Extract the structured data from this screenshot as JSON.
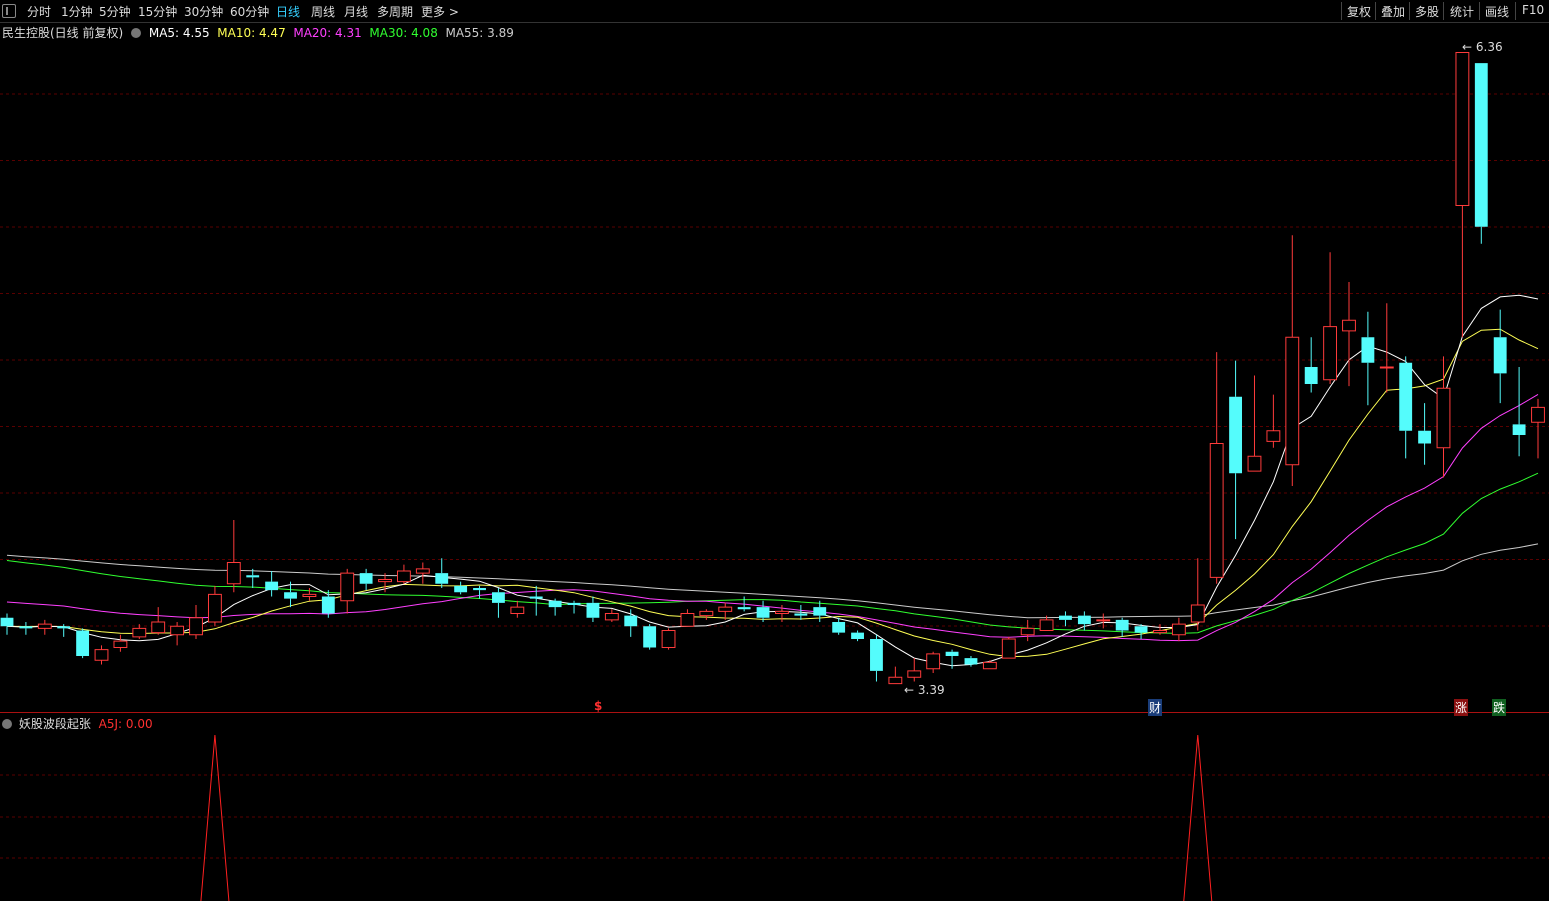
{
  "toolbar": {
    "periods": [
      "分时",
      "1分钟",
      "5分钟",
      "15分钟",
      "30分钟",
      "60分钟",
      "日线",
      "周线",
      "月线",
      "多周期",
      "更多 >"
    ],
    "active_period": "日线",
    "right_buttons": [
      "复权",
      "叠加",
      "多股",
      "统计",
      "画线",
      "F10"
    ]
  },
  "main_chart": {
    "title": "民生控股(日线 前复权)",
    "ma": [
      {
        "label": "MA5:",
        "value": "4.55",
        "color": "#ffffff"
      },
      {
        "label": "MA10:",
        "value": "4.47",
        "color": "#ffff55"
      },
      {
        "label": "MA20:",
        "value": "4.31",
        "color": "#ff40ff"
      },
      {
        "label": "MA30:",
        "value": "4.08",
        "color": "#30ff30"
      },
      {
        "label": "MA55:",
        "value": "3.89",
        "color": "#cccccc"
      }
    ],
    "high_label": "6.36",
    "low_label": "3.39",
    "markers": [
      {
        "text": "$",
        "color": "#ff3030"
      },
      {
        "text": "财",
        "color": "#ffffff",
        "bg": "#1a3d7a"
      },
      {
        "text": "涨",
        "color": "#ffffff",
        "bg": "#8a1010"
      },
      {
        "text": "跌",
        "color": "#ffffff",
        "bg": "#106020"
      }
    ]
  },
  "sub_chart": {
    "title": "妖股波段起张",
    "indicator": "A5J: 0.00"
  },
  "colors": {
    "up": "#ff3b3b",
    "down": "#54fcfc",
    "grid": "#5a0000",
    "ma5": "#ffffff",
    "ma10": "#ffff55",
    "ma20": "#ff40ff",
    "ma30": "#30ff30",
    "ma55": "#cccccc"
  },
  "chart_data": {
    "type": "candlestick",
    "series_order": [
      "open",
      "close",
      "high",
      "low"
    ],
    "candles": [
      [
        3.7,
        3.66,
        3.72,
        3.62
      ],
      [
        3.66,
        3.65,
        3.68,
        3.62
      ],
      [
        3.65,
        3.67,
        3.69,
        3.62
      ],
      [
        3.66,
        3.65,
        3.67,
        3.61
      ],
      [
        3.64,
        3.52,
        3.65,
        3.51
      ],
      [
        3.5,
        3.55,
        3.57,
        3.48
      ],
      [
        3.56,
        3.59,
        3.62,
        3.54
      ],
      [
        3.61,
        3.65,
        3.67,
        3.6
      ],
      [
        3.63,
        3.68,
        3.75,
        3.62
      ],
      [
        3.62,
        3.66,
        3.68,
        3.57
      ],
      [
        3.62,
        3.7,
        3.76,
        3.6
      ],
      [
        3.68,
        3.81,
        3.85,
        3.66
      ],
      [
        3.86,
        3.96,
        4.16,
        3.82
      ],
      [
        3.9,
        3.89,
        3.93,
        3.84
      ],
      [
        3.87,
        3.83,
        3.92,
        3.8
      ],
      [
        3.82,
        3.79,
        3.87,
        3.75
      ],
      [
        3.8,
        3.81,
        3.84,
        3.78
      ],
      [
        3.8,
        3.72,
        3.83,
        3.7
      ],
      [
        3.78,
        3.91,
        3.93,
        3.72
      ],
      [
        3.91,
        3.86,
        3.93,
        3.83
      ],
      [
        3.87,
        3.88,
        3.91,
        3.82
      ],
      [
        3.87,
        3.92,
        3.95,
        3.86
      ],
      [
        3.91,
        3.93,
        3.96,
        3.86
      ],
      [
        3.91,
        3.86,
        3.98,
        3.84
      ],
      [
        3.85,
        3.82,
        3.87,
        3.81
      ],
      [
        3.84,
        3.83,
        3.85,
        3.79
      ],
      [
        3.82,
        3.77,
        3.84,
        3.7
      ],
      [
        3.72,
        3.75,
        3.78,
        3.7
      ],
      [
        3.8,
        3.79,
        3.85,
        3.71
      ],
      [
        3.78,
        3.75,
        3.79,
        3.71
      ],
      [
        3.77,
        3.76,
        3.78,
        3.72
      ],
      [
        3.77,
        3.7,
        3.8,
        3.68
      ],
      [
        3.69,
        3.72,
        3.74,
        3.68
      ],
      [
        3.71,
        3.66,
        3.74,
        3.61
      ],
      [
        3.66,
        3.56,
        3.67,
        3.55
      ],
      [
        3.56,
        3.64,
        3.65,
        3.55
      ],
      [
        3.66,
        3.72,
        3.74,
        3.66
      ],
      [
        3.71,
        3.73,
        3.74,
        3.69
      ],
      [
        3.73,
        3.75,
        3.77,
        3.69
      ],
      [
        3.75,
        3.74,
        3.8,
        3.73
      ],
      [
        3.75,
        3.7,
        3.78,
        3.68
      ],
      [
        3.72,
        3.73,
        3.76,
        3.68
      ],
      [
        3.72,
        3.71,
        3.76,
        3.69
      ],
      [
        3.75,
        3.71,
        3.78,
        3.68
      ],
      [
        3.68,
        3.63,
        3.7,
        3.62
      ],
      [
        3.63,
        3.6,
        3.64,
        3.59
      ],
      [
        3.6,
        3.45,
        3.62,
        3.4
      ],
      [
        3.39,
        3.42,
        3.47,
        3.39
      ],
      [
        3.42,
        3.45,
        3.51,
        3.4
      ],
      [
        3.46,
        3.53,
        3.54,
        3.44
      ],
      [
        3.54,
        3.52,
        3.55,
        3.46
      ],
      [
        3.51,
        3.48,
        3.52,
        3.47
      ],
      [
        3.46,
        3.49,
        3.5,
        3.46
      ],
      [
        3.51,
        3.6,
        3.61,
        3.51
      ],
      [
        3.62,
        3.65,
        3.69,
        3.59
      ],
      [
        3.64,
        3.69,
        3.71,
        3.64
      ],
      [
        3.71,
        3.69,
        3.73,
        3.66
      ],
      [
        3.71,
        3.67,
        3.73,
        3.64
      ],
      [
        3.69,
        3.69,
        3.72,
        3.65
      ],
      [
        3.69,
        3.64,
        3.7,
        3.61
      ],
      [
        3.66,
        3.63,
        3.67,
        3.6
      ],
      [
        3.63,
        3.64,
        3.67,
        3.62
      ],
      [
        3.62,
        3.67,
        3.7,
        3.59
      ],
      [
        3.68,
        3.76,
        3.98,
        3.64
      ],
      [
        3.89,
        4.52,
        4.95,
        3.86
      ],
      [
        4.74,
        4.38,
        4.91,
        4.07
      ],
      [
        4.39,
        4.46,
        4.84,
        4.43
      ],
      [
        4.53,
        4.58,
        4.75,
        4.5
      ],
      [
        4.42,
        5.02,
        5.5,
        4.32
      ],
      [
        4.88,
        4.8,
        5.02,
        4.76
      ],
      [
        4.82,
        5.07,
        5.42,
        4.8
      ],
      [
        5.05,
        5.1,
        5.28,
        4.79
      ],
      [
        5.02,
        4.9,
        5.14,
        4.7
      ],
      [
        4.88,
        4.88,
        5.18,
        4.76
      ],
      [
        4.9,
        4.58,
        4.93,
        4.45
      ],
      [
        4.58,
        4.52,
        4.71,
        4.42
      ],
      [
        4.5,
        4.78,
        4.93,
        4.36
      ],
      [
        5.64,
        6.36,
        6.36,
        5.02
      ],
      [
        6.31,
        5.54,
        6.31,
        5.46
      ],
      [
        5.02,
        4.85,
        5.15,
        4.71
      ],
      [
        4.61,
        4.56,
        4.88,
        4.46
      ],
      [
        4.62,
        4.69,
        4.73,
        4.45
      ]
    ],
    "ma5_last": 4.55,
    "ma10_last": 4.47,
    "ma20_last": 4.31,
    "ma30_last": 4.08,
    "ma55_last": 3.89,
    "price_range": [
      3.36,
      6.4
    ],
    "signal_indices": [
      11,
      63
    ]
  }
}
